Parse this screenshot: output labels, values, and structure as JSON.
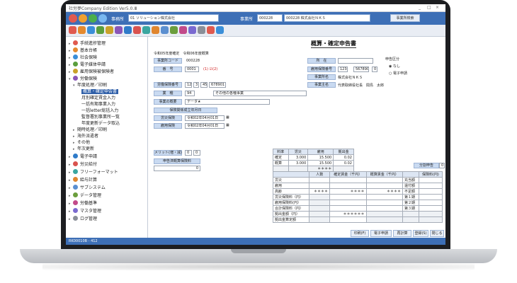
{
  "app": {
    "title": "社労夢Company Edition Ver5.0.Ⅲ",
    "window_buttons": [
      "_",
      "□",
      "×"
    ]
  },
  "toolbar": {
    "office_label": "事務所",
    "office_value": "01 ソリューション株式会社",
    "employer_label": "事業所",
    "employer_code": "000228",
    "employer_name": "000228 株式会社ＮＫＳ",
    "search_button": "事業所検索"
  },
  "sidebar": {
    "items": [
      {
        "label": "手続進捗管理",
        "color": "#e05a4f"
      },
      {
        "label": "基本台帳",
        "color": "#e58a2f"
      },
      {
        "label": "社会保険",
        "color": "#3b8fd8"
      },
      {
        "label": "電子媒体申請",
        "color": "#5a9e3d"
      },
      {
        "label": "雇用保険被保険者",
        "color": "#c9a12a"
      },
      {
        "label": "労働保険",
        "color": "#8a56b8"
      }
    ],
    "sub": {
      "group": "年度処理／印刷",
      "children": [
        "概算・確定申告書",
        "月別確定賃金入力",
        "一括有期事業入力",
        "一括letter総括入力",
        "監督署別事業所一覧",
        "年度更新データ取込"
      ],
      "after": [
        "随時処理／印刷",
        "海外派遣者",
        "その他",
        "年次更新"
      ]
    },
    "items2": [
      {
        "label": "電子申請",
        "color": "#2f7bc9"
      },
      {
        "label": "労災給付",
        "color": "#d9534f"
      },
      {
        "label": "フリーフォーマット",
        "color": "#3aa6a0"
      },
      {
        "label": "給与計算",
        "color": "#e0862f"
      },
      {
        "label": "サブシステム",
        "color": "#5b8fd0"
      },
      {
        "label": "データ管理",
        "color": "#6b9e3d"
      },
      {
        "label": "労働基準",
        "color": "#c24a8a"
      },
      {
        "label": "マスタ管理",
        "color": "#7a6ad0"
      },
      {
        "label": "ログ管理",
        "color": "#8a8f98"
      }
    ]
  },
  "form": {
    "title": "概算・確定申告書",
    "year_note": "令和05年度確定　令和06年度概算",
    "employer_code_label": "事業所コード",
    "employer_code": "000228",
    "number_label": "番　号",
    "number_value": "0001",
    "number_note": "(1) ☑(2)",
    "labor_no_label": "労働保険番号",
    "labor_no": [
      "12",
      "3",
      "45",
      "678901"
    ],
    "category_label": "業　種",
    "category_code": "94",
    "category_name": "その他の各種事業",
    "business_label": "事業の概要",
    "business_value": "データ★",
    "start_date_label": "保険関係成立年月日",
    "worker_comp_label": "労災保険",
    "worker_comp_date": "令和02年04月01日",
    "employment_label": "雇用保険",
    "employment_date": "令和02年04月01日",
    "location_label": "所　在",
    "emp_ins_no_label": "雇用保険番号",
    "emp_ins_no": [
      "1234",
      "567890",
      "0"
    ],
    "company_name_label": "事業所名",
    "company_name": "株式会社ＮＫＳ",
    "owner_label": "事業主名",
    "owner": "代表取締役社長　間島　太郎",
    "report_type_title": "申告区分",
    "report_type_opt1": "なし",
    "report_type_opt2": "電子申請",
    "partial_label": "分割申告",
    "partial_value": "0",
    "rate_label": "メリット(増・減)",
    "rate_values": [
      "0",
      "0"
    ],
    "special_label": "申告済概算保険料",
    "special_value": "0"
  },
  "rates": {
    "headers": [
      "料率",
      "労災",
      "雇用",
      "拠出金"
    ],
    "rows": [
      [
        "確定",
        "3.000",
        "15.500",
        "0.02"
      ],
      [
        "概算",
        "3.000",
        "15.500",
        "0.02"
      ],
      [
        "",
        "",
        "＊＊＊＊",
        ""
      ]
    ]
  },
  "summary": {
    "headers": [
      "",
      "人数",
      "確定賃金（千円）",
      "概算賃金（千円）",
      "",
      "保険料(円)"
    ],
    "rows": [
      [
        "労災",
        "",
        "",
        "",
        "充当額",
        ""
      ],
      [
        "雇用",
        "",
        "",
        "",
        "還付額",
        ""
      ],
      [
        "高齢",
        "＊＊＊＊",
        "＊＊＊＊",
        "＊＊＊＊",
        "不足額",
        ""
      ],
      [
        "労災保険料（円）",
        "",
        "",
        "",
        "第１期",
        ""
      ],
      [
        "雇用保険料(円）",
        "",
        "",
        "",
        "第２期",
        ""
      ],
      [
        "合計保険料（円）",
        "",
        "",
        "",
        "第３期",
        ""
      ],
      [
        "拠出金額（円）",
        "",
        "＊＊＊＊＊＊",
        "",
        "",
        ""
      ],
      [
        "拠出金算定額",
        "",
        "",
        "",
        "",
        ""
      ]
    ]
  },
  "footer_buttons": [
    "印刷(F)",
    "電子申請",
    "再計算",
    "登録(S)",
    "閉じる"
  ],
  "status_bar": "RK00010B - 412"
}
